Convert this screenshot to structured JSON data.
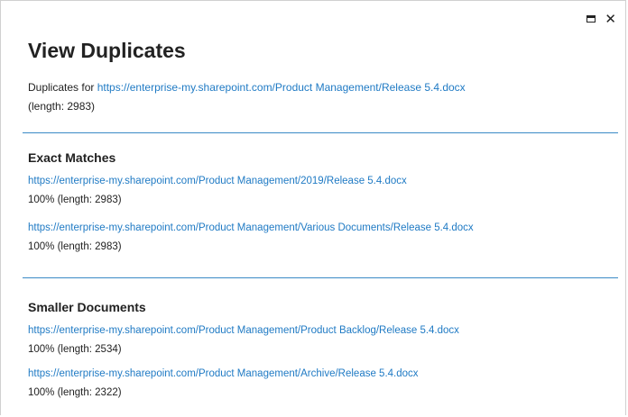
{
  "window": {
    "title": "View Duplicates"
  },
  "intro": {
    "prefix": "Duplicates for ",
    "url": "https://enterprise-my.sharepoint.com/Product Management/Release 5.4.docx",
    "length": "(length: 2983)"
  },
  "sections": {
    "exact": {
      "title": "Exact Matches",
      "items": [
        {
          "url": "https://enterprise-my.sharepoint.com/Product Management/2019/Release 5.4.docx",
          "meta": "100% (length: 2983)"
        },
        {
          "url": "https://enterprise-my.sharepoint.com/Product Management/Various Documents/Release 5.4.docx",
          "meta": "100% (length: 2983)"
        }
      ]
    },
    "smaller": {
      "title": "Smaller Documents",
      "items": [
        {
          "url": "https://enterprise-my.sharepoint.com/Product Management/Product Backlog/Release 5.4.docx",
          "meta": "100% (length: 2534)"
        },
        {
          "url": "https://enterprise-my.sharepoint.com/Product Management/Archive/Release 5.4.docx",
          "meta": "100% (length: 2322)"
        }
      ]
    }
  },
  "icons": {
    "maximize": "maximize-icon",
    "close": "close-icon"
  },
  "colors": {
    "link": "#1f7ac4",
    "divider": "#3b8ac6"
  }
}
